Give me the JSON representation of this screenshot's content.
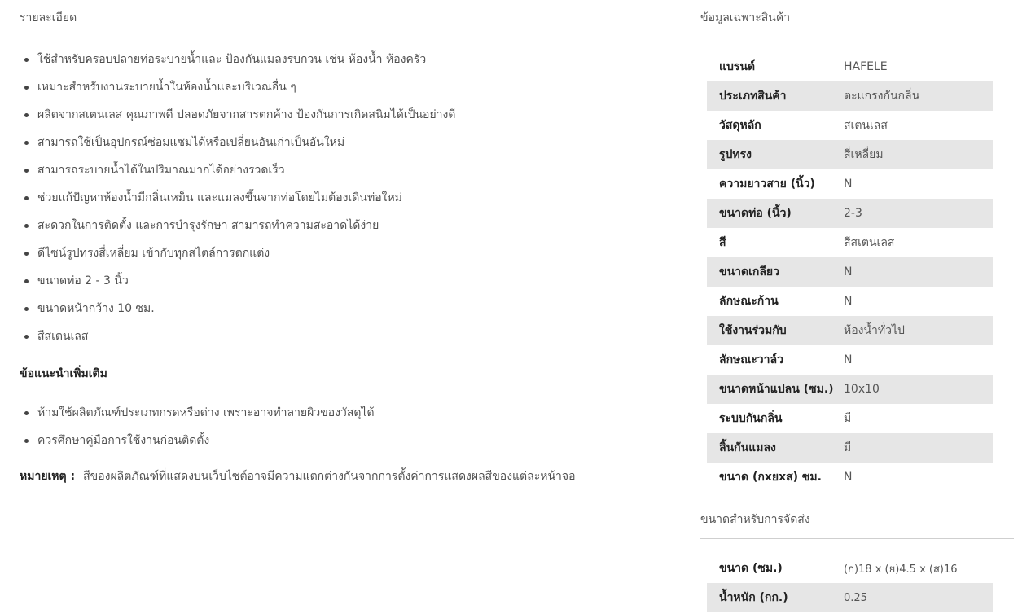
{
  "details": {
    "title": "รายละเอียด",
    "features": [
      "ใช้สำหรับครอบปลายท่อระบายน้ำและ ป้องกันแมลงรบกวน เช่น ห้องน้ำ ห้องครัว",
      "เหมาะสำหรับงานระบายน้ำในห้องน้ำและบริเวณอื่น ๆ",
      "ผลิตจากสเตนเลส คุณภาพดี ปลอดภัยจากสารตกค้าง ป้องกันการเกิดสนิมได้เป็นอย่างดี",
      "สามารถใช้เป็นอุปกรณ์ซ่อมแซมได้หรือเปลี่ยนอันเก่าเป็นอันใหม่",
      "สามารถระบายน้ำได้ในปริมาณมากได้อย่างรวดเร็ว",
      "ช่วยแก้ปัญหาห้องน้ำมีกลิ่นเหม็น และแมลงขึ้นจากท่อโดยไม่ต้องเดินท่อใหม่",
      "สะดวกในการติดตั้ง และการบำรุงรักษา สามารถทำความสะอาดได้ง่าย",
      "ดีไซน์รูปทรงสี่เหลี่ยม เข้ากับทุกสไตล์การตกแต่ง",
      "ขนาดท่อ 2 - 3 นิ้ว",
      "ขนาดหน้ากว้าง 10 ซม.",
      "สีสเตนเลส"
    ],
    "advice_title": "ข้อแนะนำเพิ่มเติม",
    "advice": [
      "ห้ามใช้ผลิตภัณฑ์ประเภทกรดหรือด่าง เพราะอาจทำลายผิวของวัสดุได้",
      "ควรศึกษาคู่มือการใช้งานก่อนติดตั้ง"
    ],
    "note_label": "หมายเหตุ :",
    "note_text": "สีของผลิตภัณฑ์ที่แสดงบนเว็บไซต์อาจมีความแตกต่างกันจากการตั้งค่าการแสดงผลสีของแต่ละหน้าจอ"
  },
  "specs": {
    "title": "ข้อมูลเฉพาะสินค้า",
    "rows": [
      {
        "key": "แบรนด์",
        "value": "HAFELE"
      },
      {
        "key": "ประเภทสินค้า",
        "value": "ตะแกรงกันกลิ่น"
      },
      {
        "key": "วัสดุหลัก",
        "value": "สเตนเลส"
      },
      {
        "key": "รูปทรง",
        "value": "สี่เหลี่ยม"
      },
      {
        "key": "ความยาวสาย (นิ้ว)",
        "value": "N"
      },
      {
        "key": "ขนาดท่อ (นิ้ว)",
        "value": "2-3"
      },
      {
        "key": "สี",
        "value": "สีสเตนเลส"
      },
      {
        "key": "ขนาดเกลียว",
        "value": "N"
      },
      {
        "key": "ลักษณะก้าน",
        "value": "N"
      },
      {
        "key": "ใช้งานร่วมกับ",
        "value": "ห้องน้ำทั่วไป"
      },
      {
        "key": "ลักษณะวาล์ว",
        "value": "N"
      },
      {
        "key": "ขนาดหน้าแปลน (ซม.)",
        "value": "10x10"
      },
      {
        "key": "ระบบกันกลิ่น",
        "value": "มี"
      },
      {
        "key": "ลิ้นกันแมลง",
        "value": "มี"
      },
      {
        "key": "ขนาด (กxยxส) ซม.",
        "value": "N"
      }
    ]
  },
  "shipping": {
    "title": "ขนาดสำหรับการจัดส่ง",
    "rows": [
      {
        "key": "ขนาด (ซม.)",
        "value": "(ก)18 x (ย)4.5 x (ส)16"
      },
      {
        "key": "น้ำหนัก (กก.)",
        "value": "0.25"
      }
    ]
  }
}
